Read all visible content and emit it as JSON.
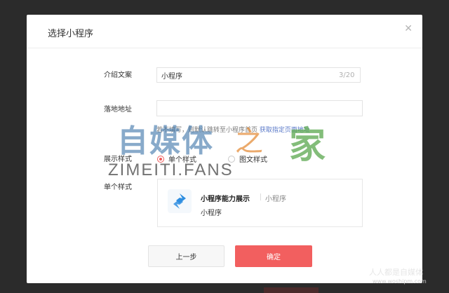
{
  "dialog": {
    "title": "选择小程序",
    "close_icon": "close-icon"
  },
  "form": {
    "intro_label": "介绍文案",
    "intro_value": "小程序",
    "intro_counter": "3/20",
    "landing_label": "落地地址",
    "landing_value": "",
    "hint_prefix": "若不填写，则默认跳转至小程序首页",
    "hint_link": "获取指定页面地址",
    "style_label": "展示样式",
    "style_options": [
      "单个样式",
      "图文样式"
    ],
    "style_selected": "单个样式",
    "single_style_label": "单个样式"
  },
  "card": {
    "name": "小程序能力展示",
    "type": "小程序",
    "subtitle": "小程序"
  },
  "buttons": {
    "prev": "上一步",
    "ok": "确定"
  },
  "watermark": {
    "big": "自媒体",
    "zhi": "之",
    "jia": "家",
    "en": "ZIMEITI.FANS",
    "corner": "人人都是自媒体",
    "corner_url": "www.woshipm.com"
  },
  "colors": {
    "accent": "#f25f5f",
    "link": "#5a79c8"
  }
}
